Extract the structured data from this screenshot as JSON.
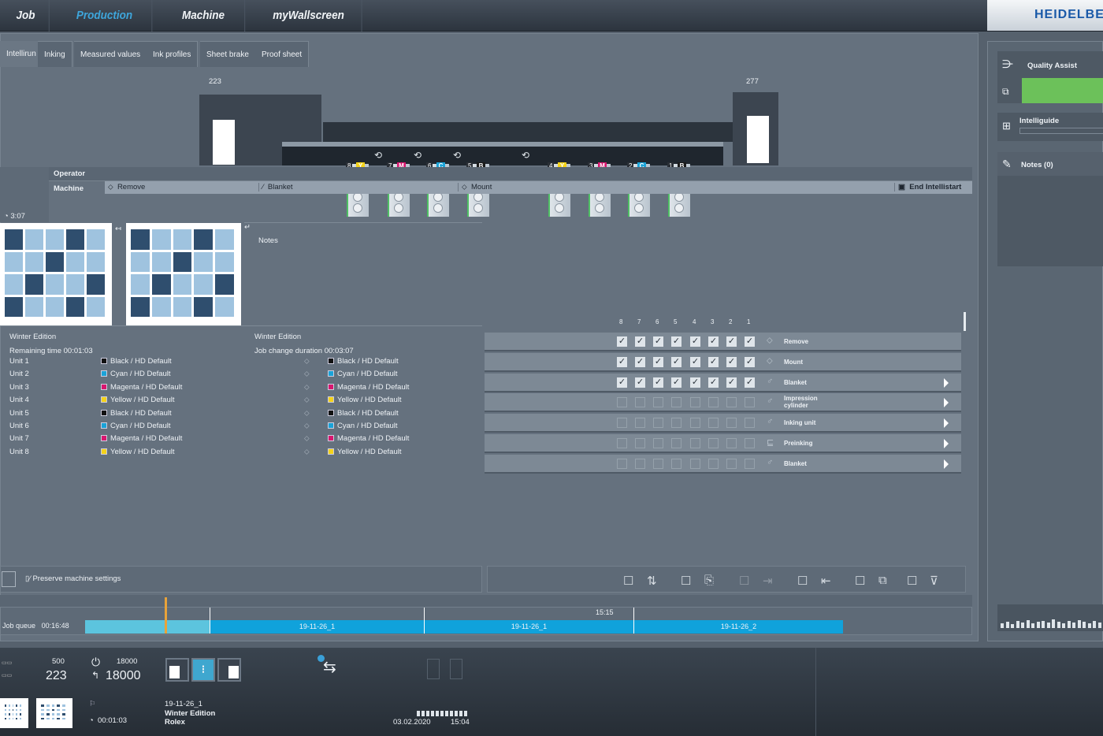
{
  "nav": {
    "tabs": [
      "Job",
      "Production",
      "Machine",
      "myWallscreen"
    ],
    "active": "Production",
    "logo": "HEIDELBERG"
  },
  "subtabs": [
    "Intellirun",
    "Inking",
    "Measured values",
    "Ink profiles",
    "Sheet brake",
    "Proof sheet"
  ],
  "press": {
    "left_count": "223",
    "right_count": "277",
    "units": [
      {
        "n": "8",
        "c": "Y",
        "color": "#f5d31a"
      },
      {
        "n": "7",
        "c": "M",
        "color": "#d8176f"
      },
      {
        "n": "6",
        "c": "C",
        "color": "#1aa3d8"
      },
      {
        "n": "5",
        "c": "B",
        "color": "#1b1b1b"
      },
      {
        "n": "4",
        "c": "Y",
        "color": "#f5d31a"
      },
      {
        "n": "3",
        "c": "M",
        "color": "#d8176f"
      },
      {
        "n": "2",
        "c": "C",
        "color": "#1aa3d8"
      },
      {
        "n": "1",
        "c": "B",
        "color": "#1b1b1b"
      }
    ]
  },
  "schedule": {
    "operator": "Operator",
    "machine": "Machine",
    "time": "3:07",
    "steps": [
      "Remove",
      "Blanket",
      "Mount",
      "End Intellistart"
    ]
  },
  "notes_label": "Notes",
  "current_job": {
    "title": "Winter Edition",
    "remaining": "Remaining time 00:01:03"
  },
  "next_job": {
    "title": "Winter Edition",
    "duration": "Job change duration 00:03:07"
  },
  "units": [
    {
      "unit": "Unit 1",
      "ink": "Black / HD Default",
      "color": "#111111"
    },
    {
      "unit": "Unit 2",
      "ink": "Cyan / HD Default",
      "color": "#1aa3d8"
    },
    {
      "unit": "Unit 3",
      "ink": "Magenta / HD Default",
      "color": "#d8176f"
    },
    {
      "unit": "Unit 4",
      "ink": "Yellow / HD Default",
      "color": "#f5d31a"
    },
    {
      "unit": "Unit 5",
      "ink": "Black / HD Default",
      "color": "#111111"
    },
    {
      "unit": "Unit 6",
      "ink": "Cyan / HD Default",
      "color": "#1aa3d8"
    },
    {
      "unit": "Unit 7",
      "ink": "Magenta / HD Default",
      "color": "#d8176f"
    },
    {
      "unit": "Unit 8",
      "ink": "Yellow / HD Default",
      "color": "#f5d31a"
    }
  ],
  "checklist": {
    "columns": [
      "8",
      "7",
      "6",
      "5",
      "4",
      "3",
      "2",
      "1"
    ],
    "rows": [
      {
        "label": "Remove",
        "checked": true,
        "arrow": false
      },
      {
        "label": "Mount",
        "checked": true,
        "arrow": false
      },
      {
        "label": "Blanket",
        "checked": true,
        "arrow": true
      },
      {
        "label": "Impression cylinder",
        "checked": false,
        "arrow": true
      },
      {
        "label": "Inking unit",
        "checked": false,
        "arrow": true
      },
      {
        "label": "Preinking",
        "checked": false,
        "arrow": true
      },
      {
        "label": "Blanket",
        "checked": false,
        "arrow": true
      }
    ]
  },
  "preserve_label": "Preserve machine settings",
  "job_queue": {
    "label": "Job queue",
    "duration": "00:16:48",
    "time_marker": "15:15",
    "jobs": [
      "19-11-26_1",
      "19-11-26_1",
      "19-11-26_2"
    ]
  },
  "right_panel": {
    "quality_assist": "Quality Assist",
    "quality_level": 1.0,
    "intelliguide": "Intelliguide",
    "notes": "Notes (0)"
  },
  "footer": {
    "target": "500",
    "count": "223",
    "speed_target": "18000",
    "speed": "18000",
    "job_id": "19-11-26_1",
    "job_name": "Winter Edition",
    "customer": "Rolex",
    "remaining": "00:01:03",
    "date": "03.02.2020",
    "time": "15:04"
  }
}
